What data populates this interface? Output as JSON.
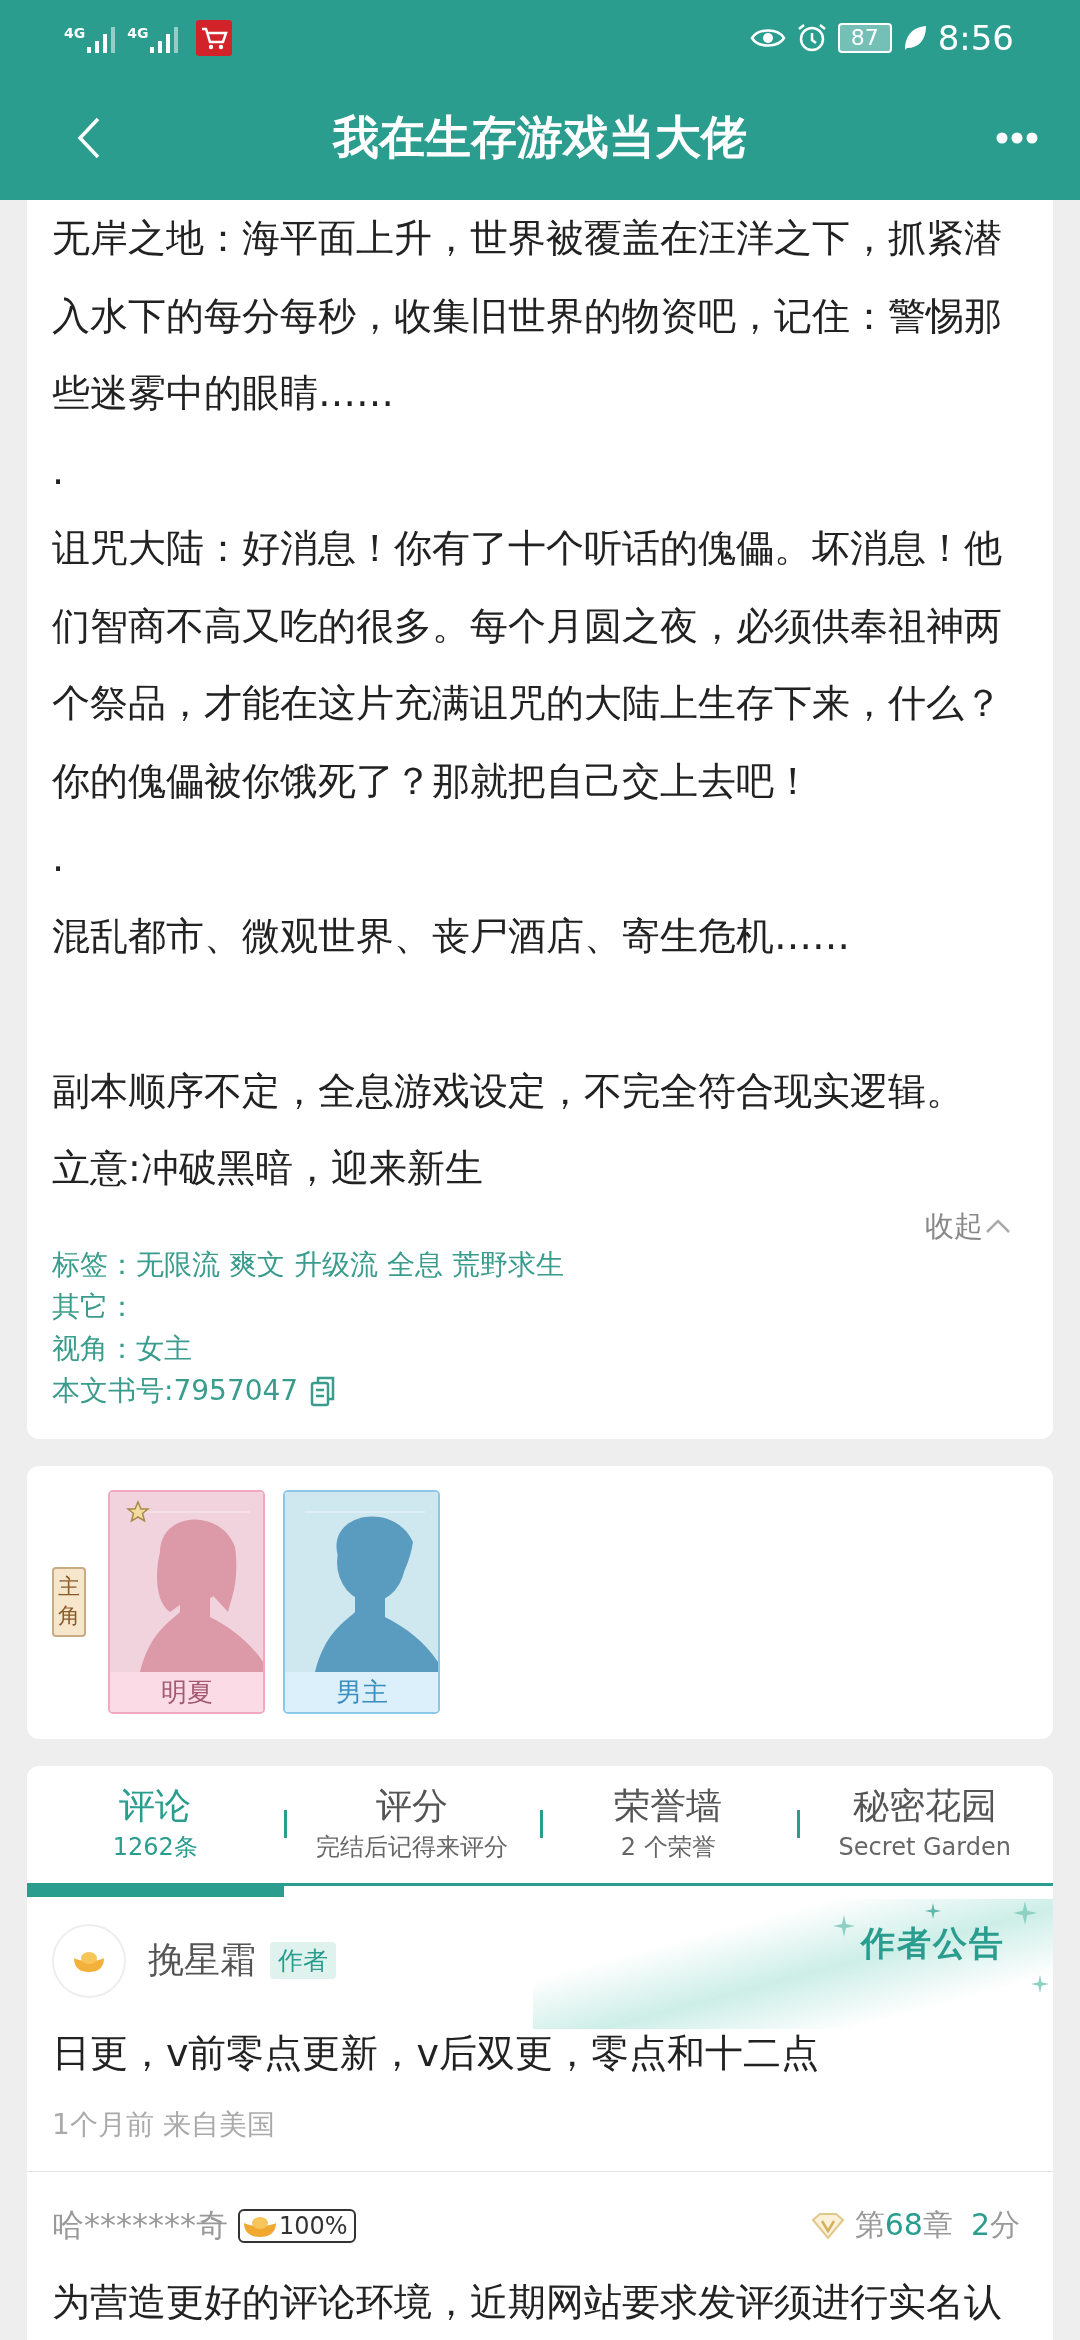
{
  "status_bar": {
    "networks": [
      "4G",
      "4G"
    ],
    "battery": "87",
    "time": "8:56"
  },
  "header": {
    "title": "我在生存游戏当大佬"
  },
  "synopsis": {
    "paragraphs": [
      {
        "kind": "text",
        "text": "无岸之地：海平面上升，世界被覆盖在汪洋之下，抓紧潜入水下的每分每秒，收集旧世界的物资吧，记住：警惕那些迷雾中的眼睛……"
      },
      {
        "kind": "text",
        "text": "."
      },
      {
        "kind": "text",
        "text": "诅咒大陆：好消息！你有了十个听话的傀儡。坏消息！他们智商不高又吃的很多。每个月圆之夜，必须供奉祖神两个祭品，才能在这片充满诅咒的大陆上生存下来，什么？你的傀儡被你饿死了？那就把自己交上去吧！"
      },
      {
        "kind": "text",
        "text": "."
      },
      {
        "kind": "text",
        "text": "混乱都市、微观世界、丧尸酒店、寄生危机……"
      },
      {
        "kind": "blank"
      },
      {
        "kind": "text",
        "text": "副本顺序不定，全息游戏设定，不完全符合现实逻辑。"
      },
      {
        "kind": "text",
        "text": "立意:冲破黑暗，迎来新生"
      }
    ],
    "collapse_label": "收起",
    "tags": {
      "label": "标签：",
      "items": [
        "无限流",
        "爽文",
        "升级流",
        "全息",
        "荒野求生"
      ]
    },
    "other": {
      "label": "其它："
    },
    "perspective": {
      "label": "视角：",
      "value": "女主"
    },
    "book_id": {
      "label": "本文书号:",
      "value": "7957047"
    }
  },
  "characters": {
    "badge": "主角",
    "cards": [
      {
        "name": "明夏",
        "kind": "heroine",
        "starred": true
      },
      {
        "name": "男主",
        "kind": "hero",
        "starred": false
      }
    ]
  },
  "tabs": [
    {
      "title": "评论",
      "subtitle": "1262条",
      "selected": true
    },
    {
      "title": "评分",
      "subtitle": "完结后记得来评分",
      "selected": false
    },
    {
      "title": "荣誉墙",
      "subtitle": "2 个荣誉",
      "selected": false
    },
    {
      "title": "秘密花园",
      "subtitle": "Secret Garden",
      "selected": false
    }
  ],
  "announcement": {
    "label": "作者公告"
  },
  "comments": [
    {
      "kind": "author",
      "user": "挽星霜",
      "role": "作者",
      "text": "日更，v前零点更新，v后双更，零点和十二点",
      "meta": "1个月前 来自美国"
    },
    {
      "kind": "reader",
      "user": "哈*******奇",
      "badge": "100%",
      "chapter": {
        "before": "第",
        "number": "68",
        "after": "章"
      },
      "score": {
        "number": "2",
        "unit": "分"
      },
      "text": "为营造更好的评论环境，近期网站要求发评须进行实名认"
    }
  ]
}
